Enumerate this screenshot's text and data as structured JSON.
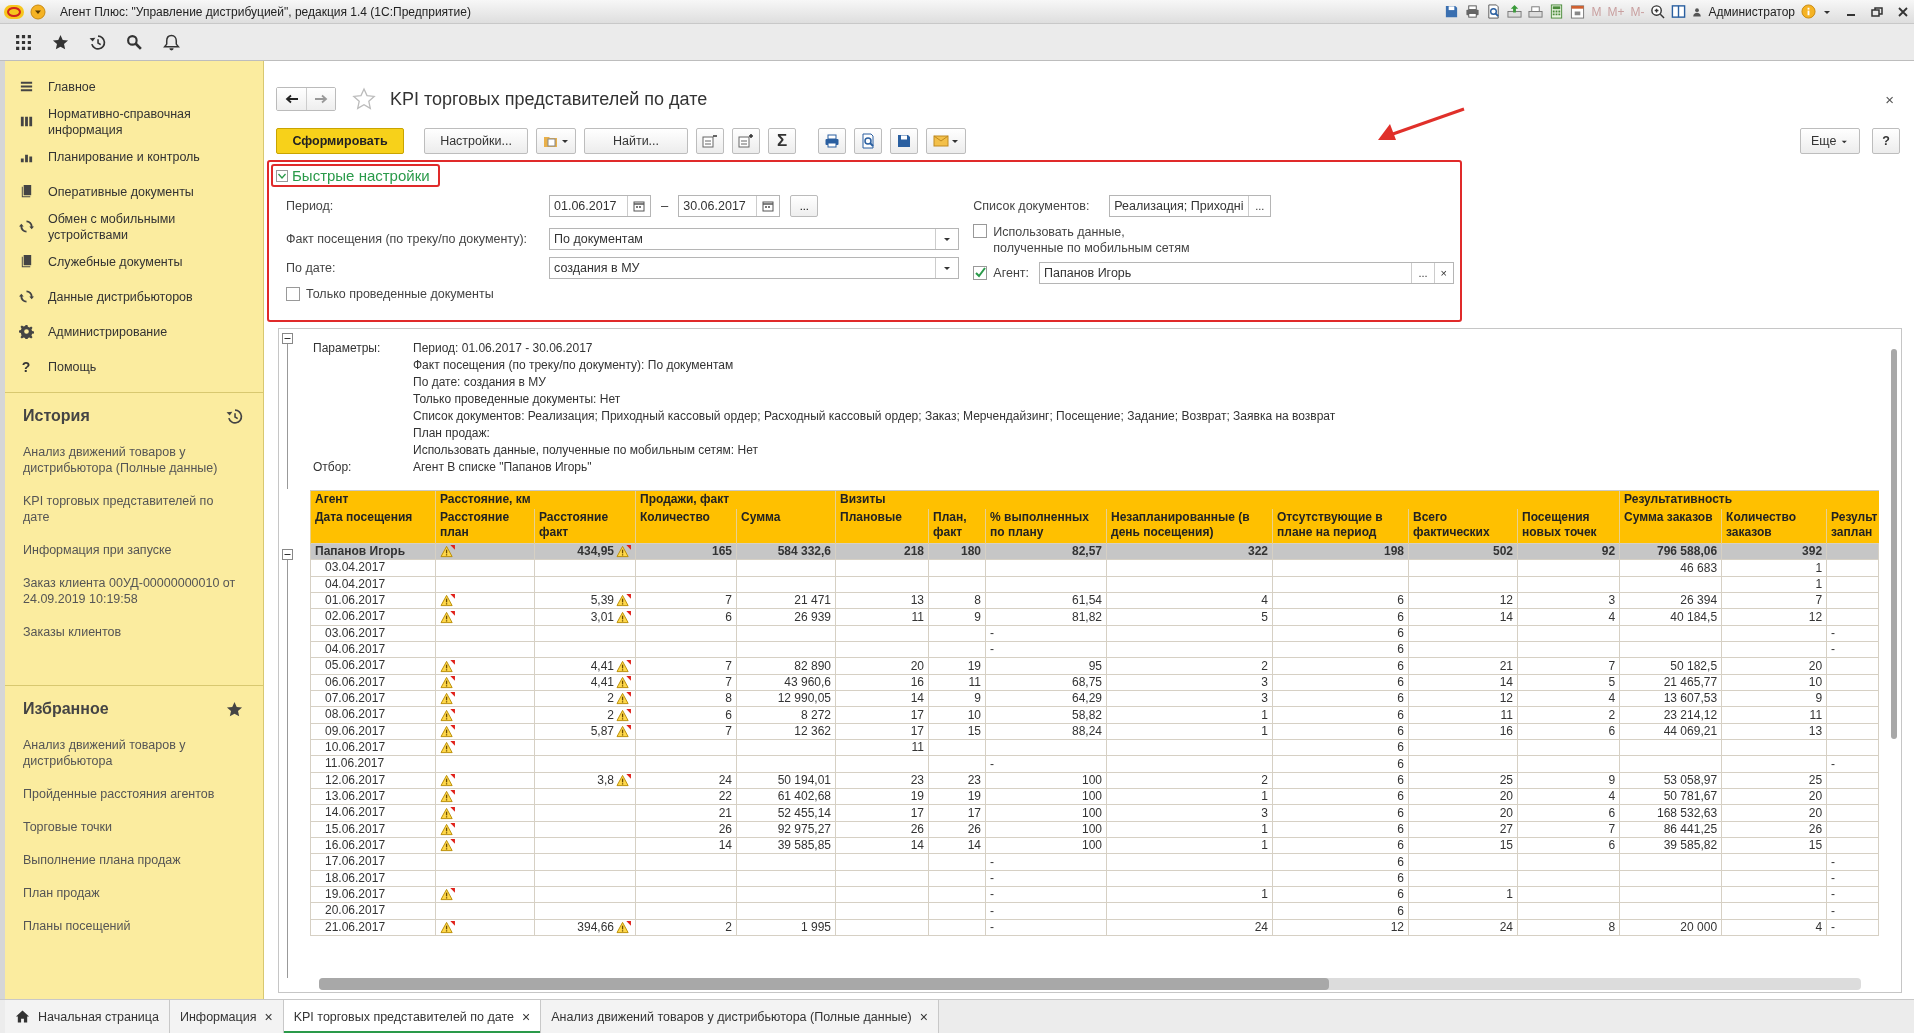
{
  "window": {
    "title": "Агент Плюс: \"Управление дистрибуцией\", редакция 1.4  (1С:Предприятие)",
    "memory_buttons": [
      "M",
      "M+",
      "M-"
    ],
    "user": "Администратор"
  },
  "sidebar": {
    "sections": [
      {
        "label": "Главное"
      },
      {
        "label": "Нормативно-справочная информация"
      },
      {
        "label": "Планирование и контроль"
      },
      {
        "label": "Оперативные документы"
      },
      {
        "label": "Обмен с мобильными устройствами"
      },
      {
        "label": "Служебные документы"
      },
      {
        "label": "Данные дистрибьюторов"
      },
      {
        "label": "Администрирование"
      },
      {
        "label": "Помощь",
        "glyph": "?"
      }
    ],
    "history": {
      "title": "История",
      "items": [
        "Анализ движений товаров у дистрибьютора (Полные данные)",
        "KPI торговых представителей по дате",
        "Информация при запуске",
        "Заказ клиента 00УД-00000000010 от 24.09.2019 10:19:58",
        "Заказы клиентов"
      ]
    },
    "favorites": {
      "title": "Избранное",
      "items": [
        "Анализ движений товаров у дистрибьютора",
        "Пройденные расстояния агентов",
        "Торговые точки",
        "Выполнение плана продаж",
        "План продаж",
        "Планы посещений"
      ]
    }
  },
  "form": {
    "title": "KPI торговых представителей по дате",
    "close": "×",
    "commands": {
      "generate": "Сформировать",
      "settings": "Настройки...",
      "find": "Найти...",
      "sum": "Σ",
      "more": "Еще",
      "help": "?"
    },
    "quick_settings": {
      "title": "Быстрые настройки",
      "expanded": true,
      "period": {
        "label": "Период:",
        "from": "01.06.2017",
        "separator": "–",
        "to": "30.06.2017",
        "button": "..."
      },
      "visit_fact": {
        "label": "Факт посещения (по треку/по документу):",
        "value": "По документам"
      },
      "by_date": {
        "label": "По дате:",
        "value": "создания в МУ"
      },
      "posted_only": {
        "label": "Только проведенные документы",
        "checked": false
      },
      "doc_list": {
        "label": "Список документов:",
        "value": "Реализация; Приходні",
        "button": "..."
      },
      "use_mobile": {
        "label": "Использовать данные,\nполученные по мобильным сетям",
        "checked": false
      },
      "agent": {
        "label": "Агент:",
        "checked": true,
        "value": "Папанов Игорь",
        "button": "...",
        "clear": "×"
      }
    }
  },
  "report": {
    "expanded": true,
    "params": [
      {
        "label": "Параметры:",
        "lines": [
          "Период: 01.06.2017 - 30.06.2017",
          "Факт посещения (по треку/по документу): По документам",
          "По дате: создания в МУ",
          "Только проведенные документы: Нет",
          "Список документов: Реализация; Приходный кассовый ордер; Расходный кассовый ордер; Заказ; Мерчендайзинг; Посещение; Задание; Возврат; Заявка на возврат",
          "План продаж:",
          "Использовать данные, полученные по мобильным сетям: Нет"
        ]
      },
      {
        "label": "Отбор:",
        "lines": [
          "Агент В списке \"Папанов Игорь\""
        ]
      }
    ],
    "header_groups": [
      {
        "label": "Агент",
        "columns": [
          "Дата посещения"
        ]
      },
      {
        "label": "Расстояние, км",
        "columns": [
          "Расстояние план",
          "Расстояние факт"
        ]
      },
      {
        "label": "Продажи, факт",
        "columns": [
          "Количество",
          "Сумма"
        ]
      },
      {
        "label": "Визиты",
        "columns": [
          "Плановые",
          "План, факт",
          "% выполненных по плану",
          "Незапланированные (в день посещения)",
          "Отсутствующие в плане на период",
          "Всего фактических",
          "Посещения новых точек"
        ]
      },
      {
        "label": "Результативность",
        "columns": [
          "Сумма заказов",
          "Количество заказов",
          "Результ заплан"
        ]
      }
    ],
    "group": {
      "name": "Папанов Игорь",
      "expanded": true,
      "plan_warning": true,
      "fact_warning": true,
      "dist_fact": "434,95",
      "qty": "165",
      "sum": "584 332,6",
      "planned": "218",
      "plan_fact": "180",
      "pct": "82,57",
      "unplanned": "322",
      "absent": "198",
      "total": "502",
      "new_points": "92",
      "order_sum": "796 588,06",
      "order_count": "392"
    },
    "rows": [
      {
        "date": "03.04.2017",
        "plan_warning": false,
        "fact_warning": false,
        "order_sum": "46 683",
        "order_count": "1"
      },
      {
        "date": "04.04.2017",
        "plan_warning": false,
        "fact_warning": false,
        "order_count": "1"
      },
      {
        "date": "01.06.2017",
        "plan_warning": true,
        "fact_warning": true,
        "dist_fact": "5,39",
        "qty": "7",
        "sum": "21 471",
        "planned": "13",
        "plan_fact": "8",
        "pct": "61,54",
        "unplanned": "4",
        "absent": "6",
        "total": "12",
        "new_points": "3",
        "order_sum": "26 394",
        "order_count": "7"
      },
      {
        "date": "02.06.2017",
        "plan_warning": true,
        "fact_warning": true,
        "dist_fact": "3,01",
        "qty": "6",
        "sum": "26 939",
        "planned": "11",
        "plan_fact": "9",
        "pct": "81,82",
        "unplanned": "5",
        "absent": "6",
        "total": "14",
        "new_points": "4",
        "order_sum": "40 184,5",
        "order_count": "12"
      },
      {
        "date": "03.06.2017",
        "plan_warning": false,
        "fact_warning": false,
        "pct": "-",
        "absent": "6",
        "result": "-"
      },
      {
        "date": "04.06.2017",
        "plan_warning": false,
        "fact_warning": false,
        "pct": "-",
        "absent": "6",
        "result": "-"
      },
      {
        "date": "05.06.2017",
        "plan_warning": true,
        "fact_warning": true,
        "dist_fact": "4,41",
        "qty": "7",
        "sum": "82 890",
        "planned": "20",
        "plan_fact": "19",
        "pct": "95",
        "unplanned": "2",
        "absent": "6",
        "total": "21",
        "new_points": "7",
        "order_sum": "50 182,5",
        "order_count": "20"
      },
      {
        "date": "06.06.2017",
        "plan_warning": true,
        "fact_warning": true,
        "dist_fact": "4,41",
        "qty": "7",
        "sum": "43 960,6",
        "planned": "16",
        "plan_fact": "11",
        "pct": "68,75",
        "unplanned": "3",
        "absent": "6",
        "total": "14",
        "new_points": "5",
        "order_sum": "21 465,77",
        "order_count": "10"
      },
      {
        "date": "07.06.2017",
        "plan_warning": true,
        "fact_warning": true,
        "dist_fact": "2",
        "qty": "8",
        "sum": "12 990,05",
        "planned": "14",
        "plan_fact": "9",
        "pct": "64,29",
        "unplanned": "3",
        "absent": "6",
        "total": "12",
        "new_points": "4",
        "order_sum": "13 607,53",
        "order_count": "9"
      },
      {
        "date": "08.06.2017",
        "plan_warning": true,
        "fact_warning": true,
        "dist_fact": "2",
        "qty": "6",
        "sum": "8 272",
        "planned": "17",
        "plan_fact": "10",
        "pct": "58,82",
        "unplanned": "1",
        "absent": "6",
        "total": "11",
        "new_points": "2",
        "order_sum": "23 214,12",
        "order_count": "11"
      },
      {
        "date": "09.06.2017",
        "plan_warning": true,
        "fact_warning": true,
        "dist_fact": "5,87",
        "qty": "7",
        "sum": "12 362",
        "planned": "17",
        "plan_fact": "15",
        "pct": "88,24",
        "unplanned": "1",
        "absent": "6",
        "total": "16",
        "new_points": "6",
        "order_sum": "44 069,21",
        "order_count": "13"
      },
      {
        "date": "10.06.2017",
        "plan_warning": true,
        "fact_warning": false,
        "planned": "11",
        "absent": "6"
      },
      {
        "date": "11.06.2017",
        "plan_warning": false,
        "fact_warning": false,
        "pct": "-",
        "absent": "6",
        "result": "-"
      },
      {
        "date": "12.06.2017",
        "plan_warning": true,
        "fact_warning": true,
        "dist_fact": "3,8",
        "qty": "24",
        "sum": "50 194,01",
        "planned": "23",
        "plan_fact": "23",
        "pct": "100",
        "unplanned": "2",
        "absent": "6",
        "total": "25",
        "new_points": "9",
        "order_sum": "53 058,97",
        "order_count": "25"
      },
      {
        "date": "13.06.2017",
        "plan_warning": true,
        "fact_warning": false,
        "qty": "22",
        "sum": "61 402,68",
        "planned": "19",
        "plan_fact": "19",
        "pct": "100",
        "unplanned": "1",
        "absent": "6",
        "total": "20",
        "new_points": "4",
        "order_sum": "50 781,67",
        "order_count": "20"
      },
      {
        "date": "14.06.2017",
        "plan_warning": true,
        "fact_warning": false,
        "qty": "21",
        "sum": "52 455,14",
        "planned": "17",
        "plan_fact": "17",
        "pct": "100",
        "unplanned": "3",
        "absent": "6",
        "total": "20",
        "new_points": "6",
        "order_sum": "168 532,63",
        "order_count": "20"
      },
      {
        "date": "15.06.2017",
        "plan_warning": true,
        "fact_warning": false,
        "qty": "26",
        "sum": "92 975,27",
        "planned": "26",
        "plan_fact": "26",
        "pct": "100",
        "unplanned": "1",
        "absent": "6",
        "total": "27",
        "new_points": "7",
        "order_sum": "86 441,25",
        "order_count": "26"
      },
      {
        "date": "16.06.2017",
        "plan_warning": true,
        "fact_warning": false,
        "qty": "14",
        "sum": "39 585,85",
        "planned": "14",
        "plan_fact": "14",
        "pct": "100",
        "unplanned": "1",
        "absent": "6",
        "total": "15",
        "new_points": "6",
        "order_sum": "39 585,82",
        "order_count": "15"
      },
      {
        "date": "17.06.2017",
        "plan_warning": false,
        "fact_warning": false,
        "pct": "-",
        "absent": "6",
        "result": "-"
      },
      {
        "date": "18.06.2017",
        "plan_warning": false,
        "fact_warning": false,
        "pct": "-",
        "absent": "6",
        "result": "-"
      },
      {
        "date": "19.06.2017",
        "plan_warning": true,
        "fact_warning": false,
        "pct": "-",
        "unplanned": "1",
        "absent": "6",
        "total": "1",
        "result": "-"
      },
      {
        "date": "20.06.2017",
        "plan_warning": false,
        "fact_warning": false,
        "pct": "-",
        "absent": "6",
        "result": "-"
      },
      {
        "date": "21.06.2017",
        "plan_warning": true,
        "fact_warning": true,
        "dist_fact": "394,66",
        "qty": "2",
        "sum": "1 995",
        "pct": "-",
        "unplanned": "24",
        "absent": "12",
        "total": "24",
        "new_points": "8",
        "order_sum": "20 000",
        "order_count": "4",
        "result": "-"
      }
    ]
  },
  "tabs": [
    {
      "label": "Начальная страница",
      "selected": false
    },
    {
      "label": "Информация",
      "selected": false,
      "close": "×"
    },
    {
      "label": "KPI торговых представителей по дате",
      "selected": true,
      "close": "×"
    },
    {
      "label": "Анализ движений товаров у дистрибьютора (Полные данные)",
      "selected": false,
      "close": "×"
    }
  ]
}
